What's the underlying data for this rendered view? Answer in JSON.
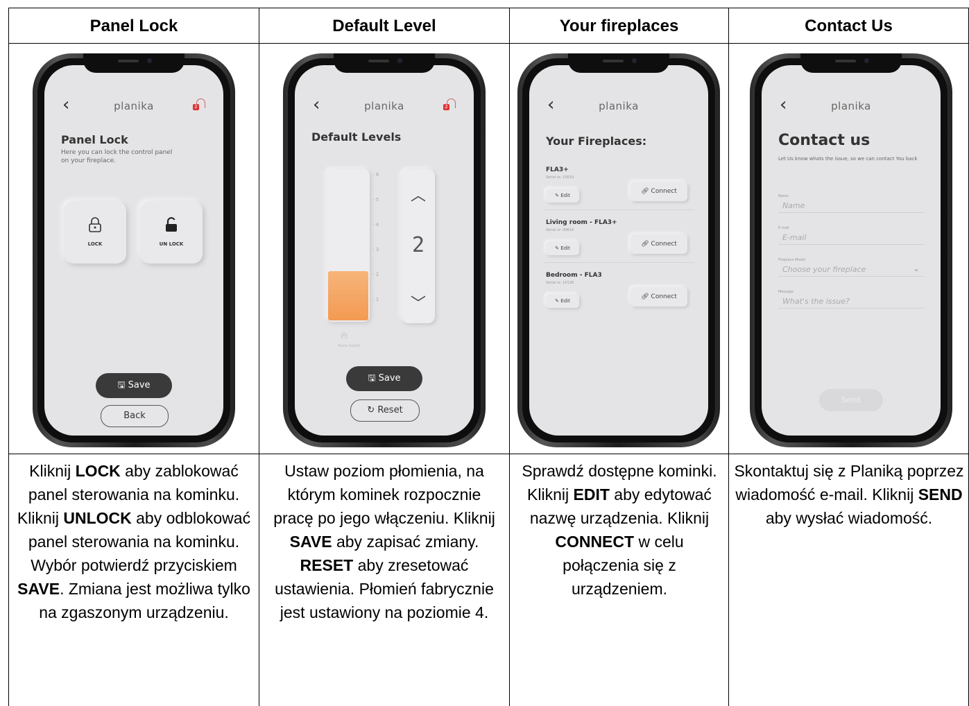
{
  "headers": [
    "Panel Lock",
    "Default Level",
    "Your fireplaces",
    "Contact Us"
  ],
  "brand": "planika",
  "badge": "2",
  "panel_lock": {
    "title": "Panel Lock",
    "subtitle": "Here you can lock the control panel on your fireplace.",
    "lock_label": "LOCK",
    "unlock_label": "UN LOCK",
    "save_label": "Save",
    "back_label": "Back"
  },
  "default_level": {
    "title": "Default Levels",
    "ticks": [
      "6",
      "5",
      "4",
      "3",
      "2",
      "1"
    ],
    "level_value": "2",
    "level_fraction": 0.33,
    "flame_caption": "flame height",
    "save_label": "Save",
    "reset_label": "Reset"
  },
  "fireplaces": {
    "title": "Your Fireplaces:",
    "edit_label": "Edit",
    "connect_label": "Connect",
    "items": [
      {
        "name": "FLA3+",
        "serial": "Serial nr: 10010"
      },
      {
        "name": "Living room - FLA3+",
        "serial": "Serial nr: 09614"
      },
      {
        "name": "Bedroom - FLA3",
        "serial": "Serial nr: 10138"
      }
    ]
  },
  "contact": {
    "title": "Contact us",
    "subtitle": "Let Us know whats the issue, so we can contact You back",
    "name_label": "Name",
    "name_placeholder": "Name",
    "email_label": "E-mail",
    "email_placeholder": "E-mail",
    "model_label": "Fireplace Model",
    "model_placeholder": "Choose your fireplace",
    "message_label": "Message",
    "message_placeholder": "What's the issue?",
    "send_label": "Send"
  },
  "descriptions": {
    "c1": [
      {
        "t": "Kliknij "
      },
      {
        "t": "LOCK",
        "b": true
      },
      {
        "t": " aby zablokować panel sterowania na kominku. Kliknij "
      },
      {
        "t": "UNLOCK",
        "b": true
      },
      {
        "t": " aby odblokować panel sterowania na kominku. Wybór potwierdź przyciskiem "
      },
      {
        "t": "SAVE",
        "b": true
      },
      {
        "t": ". Zmiana jest możliwa tylko na zgaszonym urządzeniu."
      }
    ],
    "c2": [
      {
        "t": "Ustaw poziom płomienia, na którym kominek rozpocznie pracę po jego włączeniu. Kliknij "
      },
      {
        "t": "SAVE",
        "b": true
      },
      {
        "t": " aby zapisać zmiany. "
      },
      {
        "t": "RESET",
        "b": true
      },
      {
        "t": " aby zresetować ustawienia. Płomień fabrycznie jest ustawiony na poziomie 4."
      }
    ],
    "c3": [
      {
        "t": "Sprawdź dostępne kominki. Kliknij "
      },
      {
        "t": "EDIT",
        "b": true
      },
      {
        "t": " aby edytować nazwę urządzenia. Kliknij "
      },
      {
        "t": "CONNECT",
        "b": true
      },
      {
        "t": " w celu połączenia się z urządzeniem."
      }
    ],
    "c4": [
      {
        "t": "Skontaktuj się z Planiką poprzez wiadomość e-mail. Kliknij "
      },
      {
        "t": "SEND",
        "b": true
      },
      {
        "t": " aby wysłać wiadomość."
      }
    ]
  },
  "icons": {
    "back": "chevron-left-icon",
    "bell": "bell-icon",
    "lock": "lock-icon",
    "unlock": "unlock-icon",
    "save": "save-icon",
    "reset": "reset-icon",
    "edit": "edit-icon",
    "link": "link-icon",
    "flame": "flame-icon"
  }
}
